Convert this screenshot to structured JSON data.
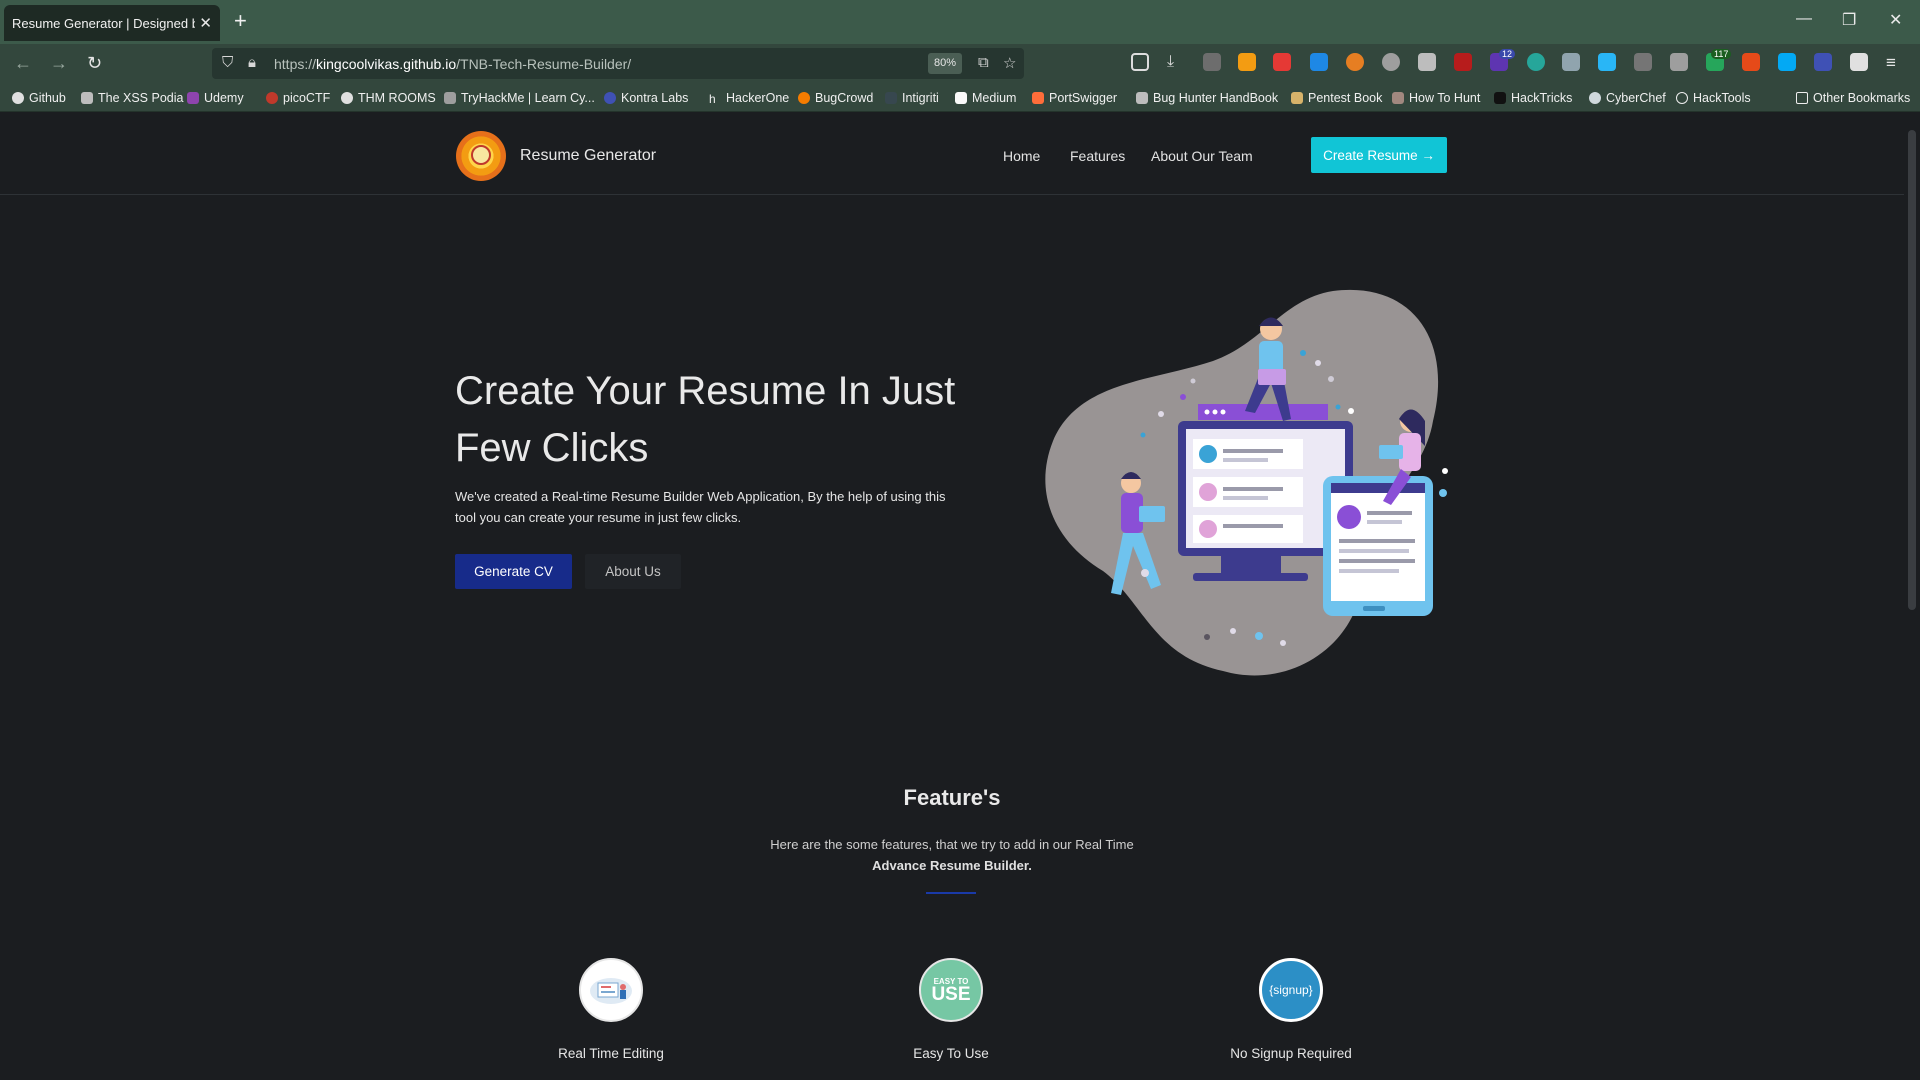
{
  "browser": {
    "tab_title": "Resume Generator | Designed by the",
    "url_prefix": "https://",
    "url_host": "kingcoolvikas.github.io",
    "url_path": "/TNB-Tech-Resume-Builder/",
    "zoom": "80%",
    "ext_badge_1": "12",
    "ext_badge_2": "117",
    "bookmarks": [
      "Github",
      "The XSS Podia",
      "Udemy",
      "picoCTF",
      "THM ROOMS",
      "TryHackMe | Learn Cy...",
      "Kontra Labs",
      "HackerOne",
      "BugCrowd",
      "Intigriti",
      "Medium",
      "PortSwigger",
      "Bug Hunter HandBook",
      "Pentest Book",
      "How To Hunt",
      "HackTricks",
      "CyberChef",
      "HackTools"
    ],
    "other_bookmarks": "Other Bookmarks"
  },
  "site": {
    "brand": "Resume Generator",
    "nav": [
      "Home",
      "Features",
      "About Our Team"
    ],
    "cta": "Create Resume →",
    "hero": {
      "title": "Create Your Resume In Just Few Clicks",
      "subtitle": "We've created a Real-time Resume Builder Web Application, By the help of using this tool you can create your resume in just few clicks.",
      "primary_button": "Generate CV",
      "secondary_button": "About Us"
    },
    "features": {
      "title": "Feature's",
      "subtitle": "Here are the some features, that we try to add in our Real Time",
      "subtitle_strong": "Advance Resume Builder.",
      "items": [
        {
          "label": "Real Time Editing",
          "icon": "real-time-editing-icon"
        },
        {
          "label": "Easy To Use",
          "icon": "easy-to-use-icon",
          "icon_text_top": "EASY TO",
          "icon_text_main": "USE"
        },
        {
          "label": "No Signup Required",
          "icon": "signup-icon",
          "icon_text_main": "{signup}"
        }
      ]
    }
  },
  "colors": {
    "primary": "#172b8a",
    "accent": "#11c5d6",
    "background": "#1b1d20",
    "browser_chrome": "#33473d"
  }
}
